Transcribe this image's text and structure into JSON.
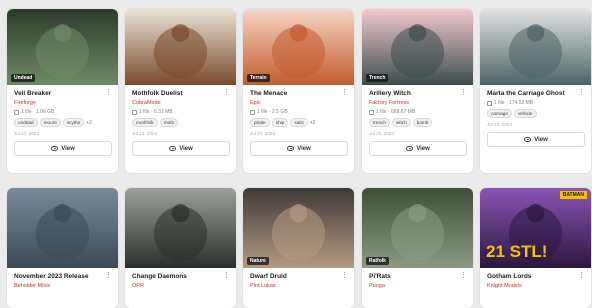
{
  "cards": [
    {
      "title": "Veil Breaker",
      "author": "Fireforge",
      "meta": "1 file · 1.06 GB",
      "tags": [
        "undead",
        "mount",
        "scythe"
      ],
      "more": "+2",
      "date": "Jul 27, 2024",
      "badge": "Undead",
      "view": "View",
      "colors": [
        "#2c3b2a",
        "#6f8a66"
      ]
    },
    {
      "title": "Mothfolk Duelist",
      "author": "CobraMode",
      "meta": "1 file · 6.31 MB",
      "tags": [
        "mothfolk",
        "moth"
      ],
      "more": "",
      "date": "Jul 13, 2024",
      "badge": "",
      "view": "View",
      "colors": [
        "#e9e3d6",
        "#7a4a2c"
      ]
    },
    {
      "title": "The Menace",
      "author": "Epic",
      "meta": "1 file · 2.5 GB",
      "tags": [
        "pirate",
        "ship",
        "sails"
      ],
      "more": "+2",
      "date": "Jul 27, 2024",
      "badge": "Terrain",
      "view": "View",
      "colors": [
        "#f6d6c4",
        "#c35b2f"
      ]
    },
    {
      "title": "Arillery Witch",
      "author": "Factory Fortress",
      "meta": "1 file · 688.67 MB",
      "tags": [
        "trench",
        "witch",
        "bomb"
      ],
      "more": "",
      "date": "Jul 25, 2024",
      "badge": "Trench",
      "view": "View",
      "colors": [
        "#f2c9cf",
        "#3d4d4d"
      ]
    },
    {
      "title": "Marta the Carriage Ghost",
      "author": "",
      "meta": "1 file · 174.52 MB",
      "tags": [
        "carriage",
        "vehicle"
      ],
      "more": "",
      "date": "Jul 10, 2024",
      "badge": "",
      "view": "View",
      "colors": [
        "#e2e2e2",
        "#4c6464"
      ]
    },
    {
      "title": "November 2023 Release",
      "author": "Beholder Minis",
      "meta": "",
      "tags": [],
      "more": "",
      "date": "",
      "badge": "",
      "view": "",
      "colors": [
        "#7a8a98",
        "#3c4a56"
      ]
    },
    {
      "title": "Change Daemons",
      "author": "OPR",
      "meta": "",
      "tags": [],
      "more": "",
      "date": "",
      "badge": "",
      "view": "",
      "colors": [
        "#9aa09a",
        "#2b2f2b"
      ]
    },
    {
      "title": "Dwarf Druid",
      "author": "Pint Lukas",
      "meta": "",
      "tags": [],
      "more": "",
      "date": "",
      "badge": "Nature",
      "view": "",
      "colors": [
        "#3f3a36",
        "#b49a82"
      ]
    },
    {
      "title": "Pi'Rats",
      "author": "Punga",
      "meta": "",
      "tags": [],
      "more": "",
      "date": "",
      "badge": "Ratfolk",
      "view": "",
      "colors": [
        "#3f4d3a",
        "#8c9a84"
      ]
    },
    {
      "title": "Gotham Lords",
      "author": "Knight Models",
      "meta": "",
      "tags": [],
      "more": "",
      "date": "",
      "badge": "",
      "view": "",
      "colors": [
        "#8c54b4",
        "#2a1840"
      ]
    }
  ],
  "banner": {
    "brand": "BATMAN",
    "headline": "21 STL!"
  }
}
